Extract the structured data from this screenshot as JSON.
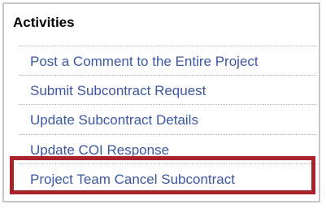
{
  "panel": {
    "title": "Activities",
    "items": [
      {
        "label": "Post a Comment to the Entire Project"
      },
      {
        "label": "Submit Subcontract Request"
      },
      {
        "label": "Update Subcontract Details"
      },
      {
        "label": "Update COI Response"
      },
      {
        "label": "Project Team Cancel Subcontract"
      }
    ],
    "highlight_color": "#a8232a",
    "link_color": "#3d57a3"
  }
}
